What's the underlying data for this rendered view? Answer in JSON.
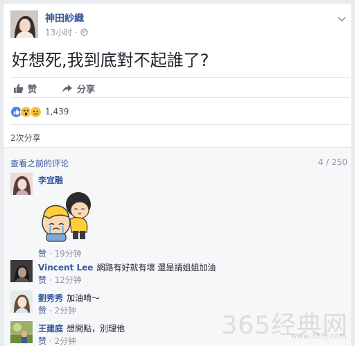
{
  "post": {
    "author": "神田紗織",
    "time": "13小时",
    "separator": "·",
    "text": "好想死,我到底對不起誰了?"
  },
  "actions": {
    "like": "赞",
    "share": "分享"
  },
  "reactions": {
    "count": "1,439",
    "icons": [
      "like-icon",
      "wow-icon",
      "sad-icon"
    ]
  },
  "shares": "2次分享",
  "comments": {
    "view_previous": "查看之前的评论",
    "page": "4 / 250",
    "items": [
      {
        "name": "李宜融",
        "text": "",
        "like": "赞",
        "sep": "·",
        "time": "19分钟",
        "sticker": true
      },
      {
        "name": "Vincent Lee",
        "text": "網路有好就有壞 還是請姐姐加油",
        "like": "赞",
        "sep": "·",
        "time": "12分钟"
      },
      {
        "name": "劉秀秀",
        "text": "加油唷～",
        "like": "赞",
        "sep": "·",
        "time": "2分钟"
      },
      {
        "name": "王建庭",
        "text": "想開點，別理他",
        "like": "赞",
        "sep": "·",
        "time": "2分钟"
      }
    ]
  },
  "watermark": {
    "main": "365经典网",
    "sub": "www.365j.com"
  },
  "colors": {
    "link": "#365899",
    "meta": "#90949c",
    "like_blue": "#4b7ee6",
    "reaction_yellow": "#f5c33b"
  }
}
